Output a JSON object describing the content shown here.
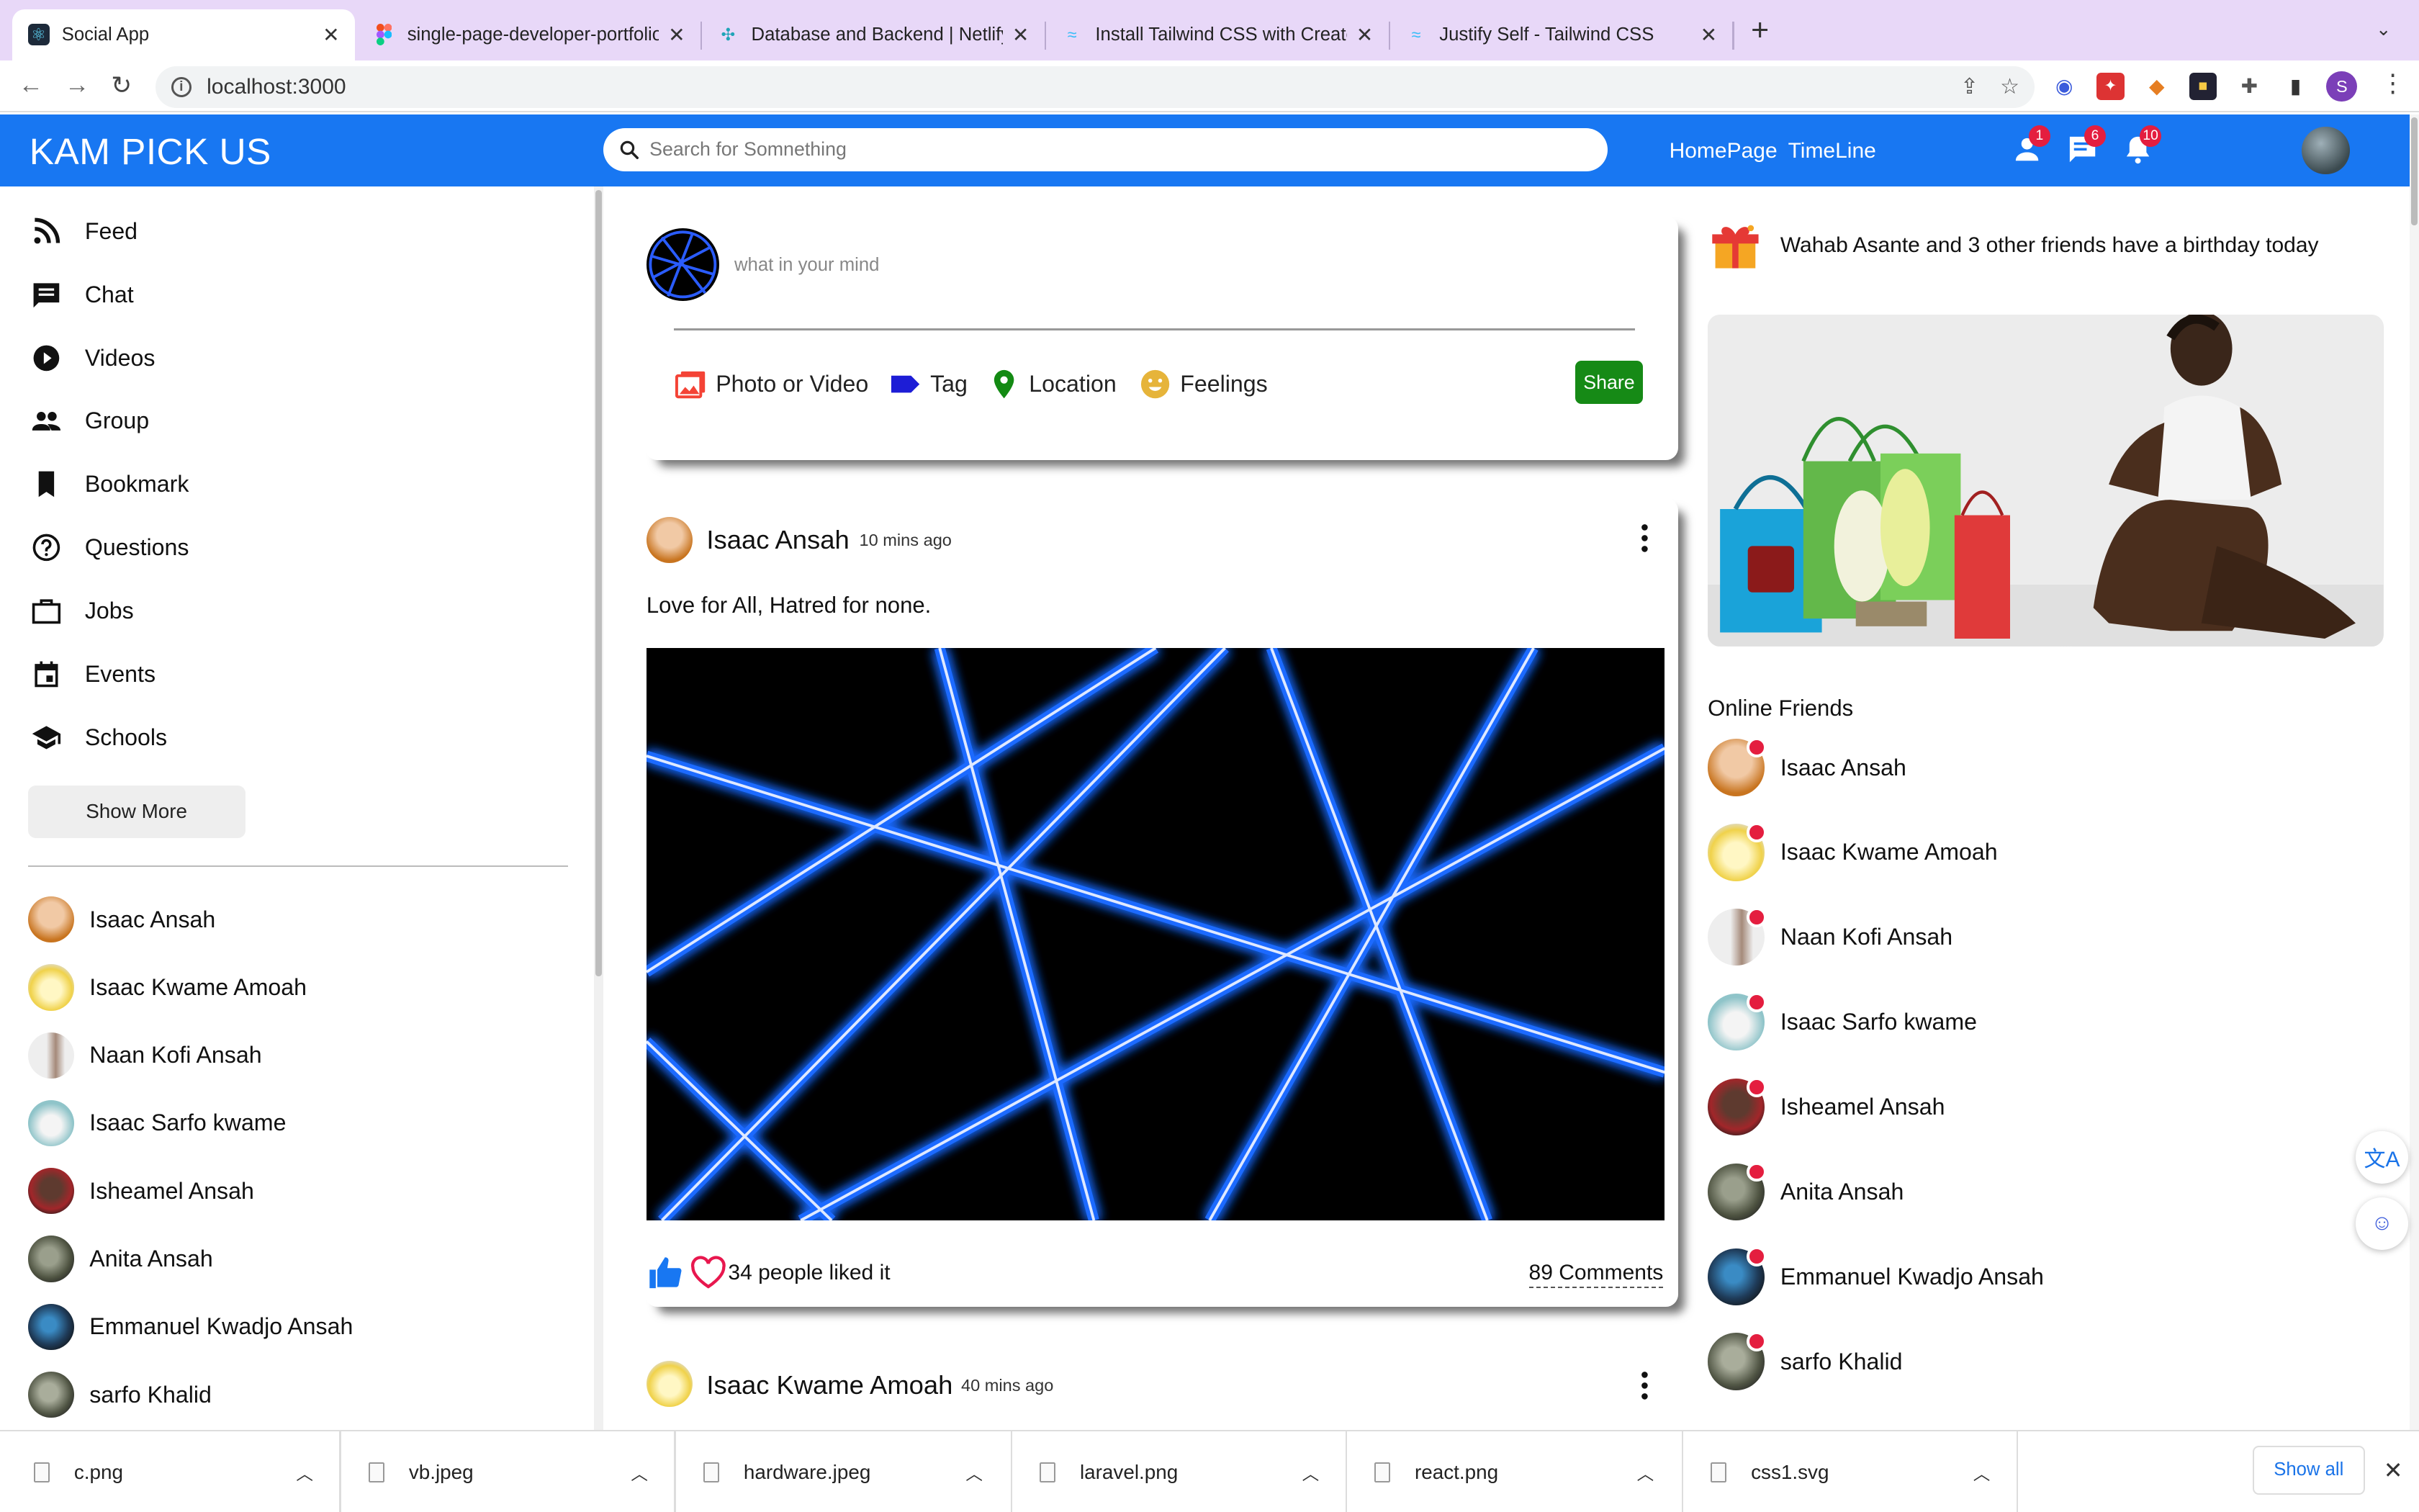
{
  "browser": {
    "tabs": [
      {
        "title": "Social App",
        "favicon": "react-icon",
        "active": true
      },
      {
        "title": "single-page-developer-portfolio",
        "favicon": "figma-icon",
        "active": false
      },
      {
        "title": "Database and Backend | Netlify",
        "favicon": "netlify-icon",
        "active": false
      },
      {
        "title": "Install Tailwind CSS with Create",
        "favicon": "tailwind-icon",
        "active": false
      },
      {
        "title": "Justify Self - Tailwind CSS",
        "favicon": "tailwind-icon",
        "active": false
      }
    ],
    "url": "localhost:3000",
    "profile_initial": "S"
  },
  "header": {
    "logo": "KAM PICK US",
    "search_placeholder": "Search for Somnething",
    "links": [
      "HomePage",
      "TimeLine"
    ],
    "badges": {
      "friends": "1",
      "messages": "6",
      "notifications": "10"
    },
    "color": "#1877f2"
  },
  "sidebar": {
    "items": [
      {
        "label": "Feed",
        "icon": "rss-icon"
      },
      {
        "label": "Chat",
        "icon": "chat-icon"
      },
      {
        "label": "Videos",
        "icon": "play-circle-icon"
      },
      {
        "label": "Group",
        "icon": "group-icon"
      },
      {
        "label": "Bookmark",
        "icon": "bookmark-icon"
      },
      {
        "label": "Questions",
        "icon": "help-circle-icon"
      },
      {
        "label": "Jobs",
        "icon": "briefcase-icon"
      },
      {
        "label": "Events",
        "icon": "calendar-icon"
      },
      {
        "label": "Schools",
        "icon": "school-icon"
      }
    ],
    "show_more": "Show More",
    "friends": [
      "Isaac Ansah",
      "Isaac Kwame Amoah",
      "Naan Kofi Ansah",
      "Isaac Sarfo kwame",
      "Isheamel Ansah",
      "Anita Ansah",
      "Emmanuel Kwadjo Ansah",
      "sarfo Khalid"
    ]
  },
  "share": {
    "placeholder": "what in your mind",
    "options": [
      "Photo or Video",
      "Tag",
      "Location",
      "Feelings"
    ],
    "button": "Share"
  },
  "posts": [
    {
      "author": "Isaac Ansah",
      "time": "10 mins ago",
      "text": "Love for All, Hatred for none.",
      "likes": "34 people liked it",
      "comments": "89 Comments"
    },
    {
      "author": "Isaac Kwame Amoah",
      "time": "40 mins ago"
    }
  ],
  "rightbar": {
    "birthday": "Wahab Asante and 3 other friends have a birthday today",
    "online_title": "Online Friends",
    "online": [
      "Isaac Ansah",
      "Isaac Kwame Amoah",
      "Naan Kofi Ansah",
      "Isaac Sarfo kwame",
      "Isheamel Ansah",
      "Anita Ansah",
      "Emmanuel Kwadjo Ansah",
      "sarfo Khalid"
    ]
  },
  "downloads": {
    "files": [
      "c.png",
      "vb.jpeg",
      "hardware.jpeg",
      "laravel.png",
      "react.png",
      "css1.svg"
    ],
    "show_all": "Show all"
  }
}
